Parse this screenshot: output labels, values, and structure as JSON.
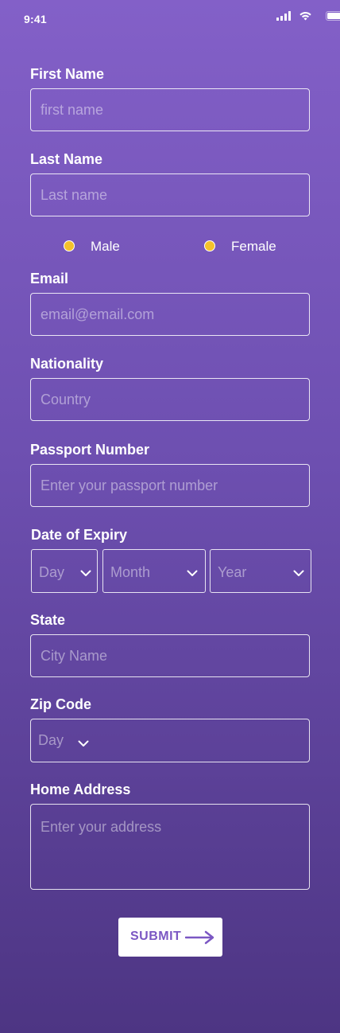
{
  "status_bar": {
    "time": "9:41"
  },
  "form": {
    "first_name": {
      "label": "First Name",
      "placeholder": "first name"
    },
    "last_name": {
      "label": "Last Name",
      "placeholder": "Last name"
    },
    "gender": {
      "options": [
        "Male",
        "Female"
      ]
    },
    "email": {
      "label": "Email",
      "placeholder": "email@email.com"
    },
    "nationality": {
      "label": "Nationality",
      "placeholder": "Country"
    },
    "passport": {
      "label": "Passport Number",
      "placeholder": "Enter your passport number"
    },
    "expiry": {
      "label": "Date of Expiry",
      "day": "Day",
      "month": "Month",
      "year": "Year"
    },
    "state": {
      "label": "State",
      "placeholder": "City Name"
    },
    "zip": {
      "label": "Zip Code",
      "placeholder": "Day"
    },
    "address": {
      "label": "Home Address",
      "placeholder": "Enter your address"
    },
    "submit_label": "SUBMIT"
  },
  "colors": {
    "background_top": "#8360c8",
    "background_bottom": "#4d3583",
    "radio_fill": "#f4c12b",
    "button_text": "#7b57c3"
  },
  "icons": [
    "signal-icon",
    "wifi-icon",
    "battery-icon",
    "chevron-down-icon",
    "arrow-right-icon"
  ]
}
